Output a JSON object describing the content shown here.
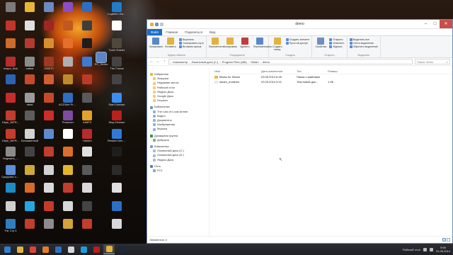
{
  "desktop": {
    "icons": [
      {
        "label": "",
        "color": "#7c7c7c",
        "col": 0,
        "row": 0
      },
      {
        "label": "",
        "color": "#e8b637",
        "col": 1,
        "row": 0
      },
      {
        "label": "",
        "color": "#6d8ac2",
        "col": 2,
        "row": 0
      },
      {
        "label": "",
        "color": "#8b4dc4",
        "col": 3,
        "row": 0
      },
      {
        "label": "",
        "color": "#2a6fc7",
        "col": 4,
        "row": 0
      },
      {
        "label": "LogMeIn Hamachi",
        "color": "#1f7cc8",
        "col": 5,
        "row": 0
      },
      {
        "label": "",
        "color": "#c4342a",
        "col": 0,
        "row": 1
      },
      {
        "label": "",
        "color": "#e0e0e0",
        "col": 1,
        "row": 1
      },
      {
        "label": "",
        "color": "#a02525",
        "col": 2,
        "row": 1
      },
      {
        "label": "",
        "color": "#c25720",
        "col": 3,
        "row": 1
      },
      {
        "label": "",
        "color": "#3d3d3d",
        "col": 4,
        "row": 1
      },
      {
        "label": "",
        "color": "#ffffff",
        "col": 5,
        "row": 1
      },
      {
        "label": "",
        "color": "#cc6b2a",
        "col": 0,
        "row": 2
      },
      {
        "label": "",
        "color": "#b33a2e",
        "col": 1,
        "row": 2
      },
      {
        "label": "",
        "color": "#d78f2d",
        "col": 2,
        "row": 2
      },
      {
        "label": "",
        "color": "#e6702b",
        "col": 3,
        "row": 2
      },
      {
        "label": "",
        "color": "#1d1d1d",
        "col": 4,
        "row": 2
      },
      {
        "label": "Tomb Raider",
        "color": "#51483c",
        "col": 5,
        "row": 2
      },
      {
        "label": "mayor_flick",
        "color": "#b52d2d",
        "col": 0,
        "row": 3
      },
      {
        "label": "cabka",
        "color": "#8b8b8b",
        "col": 1,
        "row": 3
      },
      {
        "label": "290970",
        "color": "#9d3a22",
        "col": 2,
        "row": 3
      },
      {
        "label": "",
        "color": "#b0b0b0",
        "col": 3,
        "row": 3
      },
      {
        "label": "",
        "color": "#3c7bd1",
        "col": 4,
        "row": 3
      },
      {
        "label": "The Forest",
        "color": "#434343",
        "col": 5,
        "row": 3
      },
      {
        "label": "",
        "color": "#2b63b0",
        "col": 0,
        "row": 4
      },
      {
        "label": "",
        "color": "#c64a2a",
        "col": 1,
        "row": 4
      },
      {
        "label": "",
        "color": "#d35d33",
        "col": 2,
        "row": 4
      },
      {
        "label": "",
        "color": "#bf8b2a",
        "col": 3,
        "row": 4
      },
      {
        "label": "",
        "color": "#ba3b2a",
        "col": 4,
        "row": 4
      },
      {
        "label": "",
        "color": "#444",
        "col": 5,
        "row": 4
      },
      {
        "label": "",
        "color": "#c62c2c",
        "col": 0,
        "row": 5
      },
      {
        "label": "detai",
        "color": "#9b9b9b",
        "col": 1,
        "row": 5
      },
      {
        "label": "",
        "color": "#c64a2a",
        "col": 2,
        "row": 5
      },
      {
        "label": "ACDSee Pro 3 Новая папка",
        "color": "#2f6ec2",
        "col": 3,
        "row": 5
      },
      {
        "label": "",
        "color": "#5a5a5a",
        "col": 4,
        "row": 5
      },
      {
        "label": "Start Denwer",
        "color": "#3b8df0",
        "col": 5,
        "row": 5
      },
      {
        "label": "Dbye_INFR...",
        "color": "#c33c2c",
        "col": 0,
        "row": 6
      },
      {
        "label": "",
        "color": "#5c5c5c",
        "col": 1,
        "row": 6
      },
      {
        "label": "",
        "color": "#cf2c2c",
        "col": 2,
        "row": 6
      },
      {
        "label": "Producer",
        "color": "#7e4ba1",
        "col": 3,
        "row": 6
      },
      {
        "label": "AIMP3",
        "color": "#e2a12a",
        "col": 4,
        "row": 6
      },
      {
        "label": "Stop Denwer",
        "color": "#b7221d",
        "col": 5,
        "row": 6
      },
      {
        "label": "Dbye_INFR...",
        "color": "#c33c2c",
        "col": 0,
        "row": 7
      },
      {
        "label": "Безымянный",
        "color": "#d2d2d2",
        "col": 1,
        "row": 7
      },
      {
        "label": "",
        "color": "#5d8ad1",
        "col": 2,
        "row": 7
      },
      {
        "label": "",
        "color": "#ffffff",
        "col": 3,
        "row": 7
      },
      {
        "label": "Yandex",
        "color": "#ba2b2b",
        "col": 4,
        "row": 7
      },
      {
        "label": "Restart Denwer",
        "color": "#2f7ad6",
        "col": 5,
        "row": 7
      },
      {
        "label": "Hogwarts_...",
        "color": "#8c8c8c",
        "col": 0,
        "row": 8
      },
      {
        "label": "",
        "color": "#444",
        "col": 1,
        "row": 8
      },
      {
        "label": "",
        "color": "#c33c2c",
        "col": 2,
        "row": 8
      },
      {
        "label": "",
        "color": "#dd6e2a",
        "col": 3,
        "row": 8
      },
      {
        "label": "",
        "color": "#e0e0e0",
        "col": 4,
        "row": 8
      },
      {
        "label": "",
        "color": "#1e1e1e",
        "col": 5,
        "row": 8
      },
      {
        "label": "Средство записи...",
        "color": "#5b8fd8",
        "col": 0,
        "row": 9
      },
      {
        "label": "",
        "color": "#cfa83a",
        "col": 1,
        "row": 9
      },
      {
        "label": "",
        "color": "#d2d2d2",
        "col": 2,
        "row": 9
      },
      {
        "label": "",
        "color": "#e3b52f",
        "col": 3,
        "row": 9
      },
      {
        "label": "",
        "color": "#5a5a5a",
        "col": 4,
        "row": 9
      },
      {
        "label": "",
        "color": "#2b2b2b",
        "col": 5,
        "row": 9
      },
      {
        "label": "",
        "color": "#1e8bc7",
        "col": 0,
        "row": 10
      },
      {
        "label": "",
        "color": "#d86a2a",
        "col": 1,
        "row": 10
      },
      {
        "label": "",
        "color": "#d9d9d9",
        "col": 2,
        "row": 10
      },
      {
        "label": "",
        "color": "#c33c2c",
        "col": 3,
        "row": 10
      },
      {
        "label": "",
        "color": "#d9d9d9",
        "col": 4,
        "row": 10
      },
      {
        "label": "",
        "color": "#e0e0e0",
        "col": 5,
        "row": 10
      },
      {
        "label": "",
        "color": "#cfcfcf",
        "col": 0,
        "row": 11
      },
      {
        "label": "",
        "color": "#23a7e0",
        "col": 1,
        "row": 11
      },
      {
        "label": "",
        "color": "#c63a2a",
        "col": 2,
        "row": 11
      },
      {
        "label": "",
        "color": "#d8d8d8",
        "col": 3,
        "row": 11
      },
      {
        "label": "",
        "color": "#444",
        "col": 4,
        "row": 11
      },
      {
        "label": "",
        "color": "#2b6fc7",
        "col": 5,
        "row": 11
      },
      {
        "label": "Far Cry 3",
        "color": "#2f7fbf",
        "col": 0,
        "row": 12
      },
      {
        "label": "",
        "color": "#c33c2c",
        "col": 1,
        "row": 12
      },
      {
        "label": "",
        "color": "#8c8c8c",
        "col": 2,
        "row": 12
      },
      {
        "label": "",
        "color": "#d4a33a",
        "col": 3,
        "row": 12
      },
      {
        "label": "",
        "color": "#c33c2c",
        "col": 4,
        "row": 12
      },
      {
        "label": "",
        "color": "#d9d9d9",
        "col": 5,
        "row": 12
      }
    ],
    "selected_icon_label": "RC_Demo"
  },
  "window": {
    "title": "demo",
    "tabs": [
      "Файл",
      "Главная",
      "Поделиться",
      "Вид"
    ],
    "ribbon": {
      "groups": [
        {
          "label": "Буфер обмена",
          "big": [
            {
              "label": "Копировать",
              "color": "#5a87c9"
            },
            {
              "label": "Вставить",
              "color": "#e2b33f"
            }
          ],
          "small": [
            "Вырезать",
            "Скопировать путь",
            "Вставить ярлык"
          ]
        },
        {
          "label": "Упорядочить",
          "big": [
            {
              "label": "Переместить",
              "color": "#e2b33f"
            },
            {
              "label": "Копировать",
              "color": "#e2b33f"
            },
            {
              "label": "Удалить",
              "color": "#c43b3b"
            },
            {
              "label": "Переименовать",
              "color": "#5a87c9"
            }
          ],
          "small": []
        },
        {
          "label": "Создать",
          "big": [
            {
              "label": "Создать папку",
              "color": "#e2b33f"
            }
          ],
          "small": [
            "Создать элемент",
            "Простой доступ"
          ]
        },
        {
          "label": "Открыть",
          "big": [
            {
              "label": "Свойства",
              "color": "#6f8fbf"
            }
          ],
          "small": [
            "Открыть",
            "Изменить",
            "Журнал"
          ]
        },
        {
          "label": "Выделить",
          "big": [],
          "small": [
            "Выделить все",
            "Снять выделение",
            "Обратить выделение"
          ]
        }
      ]
    },
    "address": {
      "crumbs": [
        "Компьютер",
        "Локальный диск (C:)",
        "Program Files (x86)",
        "Steam",
        "demo"
      ],
      "search_placeholder": "Поиск: demo"
    },
    "navpane": {
      "favorites": {
        "label": "Избранное",
        "items": [
          "Загрузки",
          "Недавние места",
          "Рабочий стол",
          "Яндекс.Диск",
          "Google Диск",
          "Dropbox"
        ]
      },
      "libraries": {
        "label": "Библиотеки",
        "items": [
          "The Last of Louis Armstr",
          "Видео",
          "Документы",
          "Изображения",
          "Музыка"
        ]
      },
      "homegroup": {
        "label": "Домашняя группа",
        "items": [
          "Добрыня"
        ]
      },
      "computer": {
        "label": "Компьютер",
        "items": [
          "Локальный диск (C:)",
          "Локальный диск (D:)",
          "Яндекс.Диск"
        ]
      },
      "network": {
        "label": "Сеть",
        "items": [
          "PC1"
        ]
      }
    },
    "columns": [
      "Имя",
      "Дата изменения",
      "Тип",
      "Размер"
    ],
    "files": [
      {
        "name": "Мапы for Steam",
        "date": "03.05.2014 8:45",
        "type": "Папка с файлами",
        "size": "",
        "icon_color": "#e7bb4c"
      },
      {
        "name": "steam_mutiems",
        "date": "03.05.2014 9:41",
        "type": "Текстовый док...",
        "size": "1 КБ",
        "icon_color": "#dfe6ef"
      }
    ],
    "status": "Элементов: 2"
  },
  "taskbar": {
    "buttons": [
      {
        "name": "start",
        "color": "#2f7fd3",
        "active": false
      },
      {
        "name": "explorer",
        "color": "#e2b33f",
        "active": false
      },
      {
        "name": "chrome",
        "color": "#e04336",
        "active": false
      },
      {
        "name": "firefox",
        "color": "#e07e2b",
        "active": false
      },
      {
        "name": "outlook",
        "color": "#2c73bf",
        "active": false
      },
      {
        "name": "media",
        "color": "#d6d6d6",
        "active": false
      },
      {
        "name": "skype",
        "color": "#1d9ddc",
        "active": false
      },
      {
        "name": "filezilla",
        "color": "#b52020",
        "active": false
      },
      {
        "name": "explorer-active",
        "color": "#e2b33f",
        "active": true
      },
      {
        "name": "steam",
        "color": "#1b2838",
        "active": false
      }
    ],
    "tray_text": "Рабочий стол",
    "time": "9:59",
    "date": "31.05.2014"
  }
}
